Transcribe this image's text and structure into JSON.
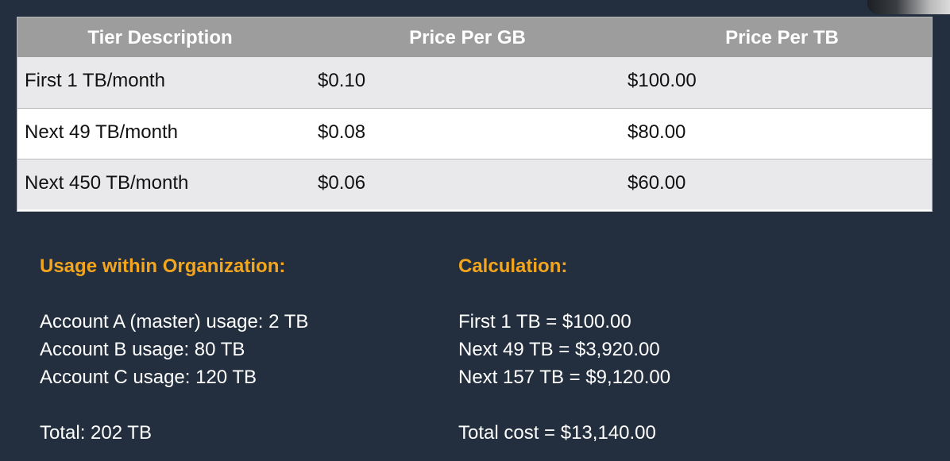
{
  "table": {
    "headers": [
      "Tier Description",
      "Price Per GB",
      "Price Per TB"
    ],
    "rows": [
      {
        "tier": "First 1 TB/month",
        "per_gb": "$0.10",
        "per_tb": "$100.00"
      },
      {
        "tier": "Next 49 TB/month",
        "per_gb": "$0.08",
        "per_tb": "$80.00"
      },
      {
        "tier": "Next 450 TB/month",
        "per_gb": "$0.06",
        "per_tb": "$60.00"
      }
    ]
  },
  "usage": {
    "heading": "Usage within Organization:",
    "lines": [
      "Account A (master) usage: 2 TB",
      "Account B usage: 80 TB",
      "Account C usage: 120 TB"
    ],
    "total": "Total: 202 TB"
  },
  "calculation": {
    "heading": "Calculation:",
    "lines": [
      "First 1 TB = $100.00",
      "Next 49 TB = $3,920.00",
      "Next 157 TB = $9,120.00"
    ],
    "total": "Total cost = $13,140.00"
  },
  "colors": {
    "background": "#232f3e",
    "header_fill": "#9d9d9d",
    "row_shaded": "#e9e9eb",
    "heading_accent": "#f3a51d"
  }
}
